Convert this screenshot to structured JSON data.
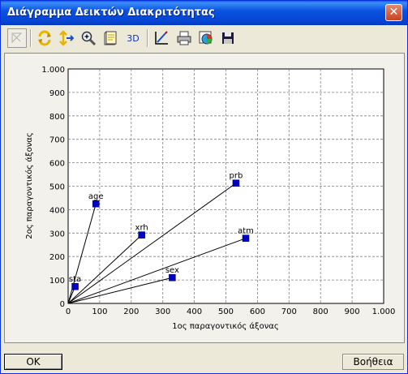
{
  "window": {
    "title": "Διάγραμμα Δεικτών Διακριτότητας",
    "close_glyph": "✕"
  },
  "toolbar": {
    "buttons": [
      {
        "name": "select-arrow-icon"
      },
      {
        "name": "refresh-icon"
      },
      {
        "name": "move-axes-icon"
      },
      {
        "name": "zoom-icon"
      },
      {
        "name": "notes-icon"
      },
      {
        "name": "3d-icon",
        "text": "3D"
      },
      {
        "name": "chart-edit-icon"
      },
      {
        "name": "printer-icon"
      },
      {
        "name": "color-palette-icon"
      },
      {
        "name": "save-disk-icon"
      }
    ]
  },
  "chart_data": {
    "type": "scatter",
    "title": "",
    "xlabel": "1ος παραγοντικός άξονας",
    "ylabel": "2ος παραγοντικός άξονας",
    "xlim": [
      0,
      1000
    ],
    "ylim": [
      0,
      1000
    ],
    "xticks": [
      "0",
      "100",
      "200",
      "300",
      "400",
      "500",
      "600",
      "700",
      "800",
      "900",
      "1.000"
    ],
    "yticks": [
      "0",
      "100",
      "200",
      "300",
      "400",
      "500",
      "600",
      "700",
      "800",
      "900",
      "1.000"
    ],
    "grid": true,
    "vectors_from_origin": true,
    "points": [
      {
        "label": "sta",
        "x": 22,
        "y": 72
      },
      {
        "label": "age",
        "x": 88,
        "y": 425
      },
      {
        "label": "xrh",
        "x": 233,
        "y": 292
      },
      {
        "label": "sex",
        "x": 330,
        "y": 110
      },
      {
        "label": "prb",
        "x": 532,
        "y": 513
      },
      {
        "label": "atm",
        "x": 563,
        "y": 278
      }
    ],
    "colors": {
      "marker": "#0000cc",
      "grid": "#808080",
      "line": "#000000"
    }
  },
  "footer": {
    "ok_label": "OK",
    "help_label": "Βοήθεια"
  }
}
